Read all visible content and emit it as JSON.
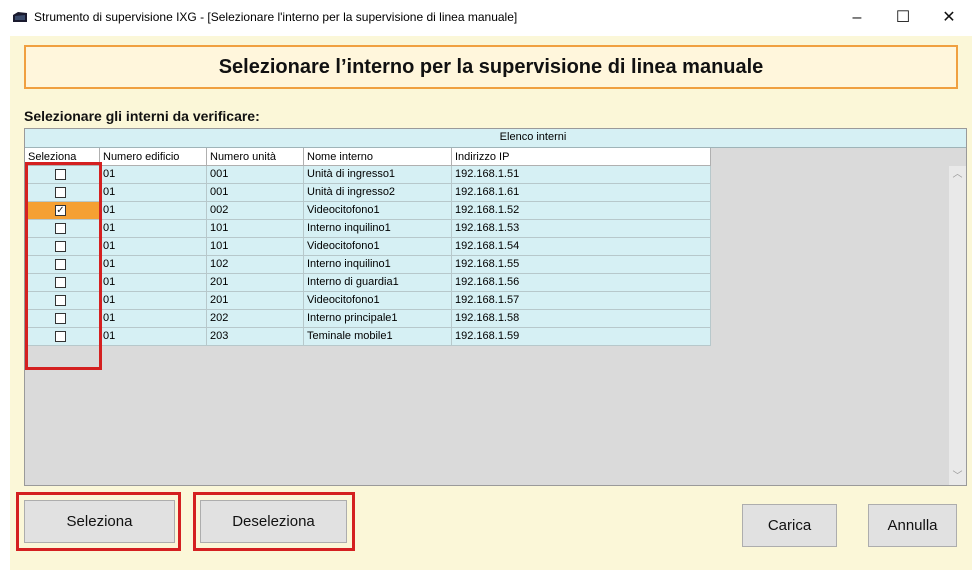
{
  "window": {
    "title": "Strumento di supervisione IXG - [Selezionare l'interno per la supervisione di linea manuale]",
    "minimize": "–",
    "maximize": "☐",
    "close": "✕",
    "app_icon": "ixg-app-icon"
  },
  "header": {
    "title": "Selezionare l’interno per la supervisione di linea manuale"
  },
  "subtitle": "Selezionare gli interni da verificare:",
  "table": {
    "group_header": "Elenco interni",
    "columns": [
      "Seleziona",
      "Numero edificio",
      "Numero unità",
      "Nome interno",
      "Indirizzo IP"
    ],
    "rows": [
      {
        "selected": false,
        "building": "01",
        "unit": "001",
        "name": "Unità di ingresso1",
        "ip": "192.168.1.51"
      },
      {
        "selected": false,
        "building": "01",
        "unit": "001",
        "name": "Unità di ingresso2",
        "ip": "192.168.1.61"
      },
      {
        "selected": true,
        "building": "01",
        "unit": "002",
        "name": "Videocitofono1",
        "ip": "192.168.1.52"
      },
      {
        "selected": false,
        "building": "01",
        "unit": "101",
        "name": "Interno inquilino1",
        "ip": "192.168.1.53"
      },
      {
        "selected": false,
        "building": "01",
        "unit": "101",
        "name": "Videocitofono1",
        "ip": "192.168.1.54"
      },
      {
        "selected": false,
        "building": "01",
        "unit": "102",
        "name": "Interno inquilino1",
        "ip": "192.168.1.55"
      },
      {
        "selected": false,
        "building": "01",
        "unit": "201",
        "name": "Interno di guardia1",
        "ip": "192.168.1.56"
      },
      {
        "selected": false,
        "building": "01",
        "unit": "201",
        "name": "Videocitofono1",
        "ip": "192.168.1.57"
      },
      {
        "selected": false,
        "building": "01",
        "unit": "202",
        "name": "Interno principale1",
        "ip": "192.168.1.58"
      },
      {
        "selected": false,
        "building": "01",
        "unit": "203",
        "name": "Teminale mobile1",
        "ip": "192.168.1.59"
      }
    ]
  },
  "buttons": {
    "select": "Seleziona",
    "deselect": "Deseleziona",
    "load": "Carica",
    "cancel": "Annulla"
  },
  "colors": {
    "highlight_red": "#d42020",
    "checked_row": "#f5a033",
    "row_background": "#d6f0f4",
    "header_border": "#f0a040"
  }
}
